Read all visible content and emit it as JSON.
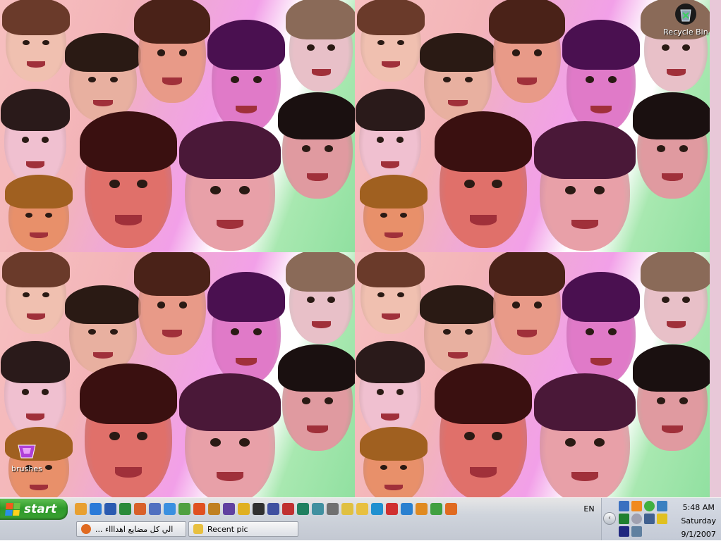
{
  "desktop": {
    "icons": [
      {
        "label": "Recycle Bin",
        "icon": "recycle-bin-icon"
      },
      {
        "label": "brushes",
        "icon": "brushes-icon"
      }
    ]
  },
  "taskbar": {
    "start_label": "start",
    "quick_launch": [
      {
        "icon": "outlook-icon",
        "color": "#e8a030"
      },
      {
        "icon": "internet-explorer-icon",
        "color": "#2a7ad8"
      },
      {
        "icon": "word-icon",
        "color": "#2a5ab0"
      },
      {
        "icon": "excel-icon",
        "color": "#2a8a3a"
      },
      {
        "icon": "powerpoint-icon",
        "color": "#d8602a"
      },
      {
        "icon": "notepad-icon",
        "color": "#5070c0"
      },
      {
        "icon": "ie-alt-icon",
        "color": "#3a90e0"
      },
      {
        "icon": "paint-icon",
        "color": "#50a040"
      },
      {
        "icon": "media-icon",
        "color": "#e05020"
      },
      {
        "icon": "winamp-icon",
        "color": "#c08020"
      },
      {
        "icon": "gallery-icon",
        "color": "#6040a0"
      },
      {
        "icon": "norton-icon",
        "color": "#e0b020"
      },
      {
        "icon": "audio-icon",
        "color": "#303030"
      },
      {
        "icon": "tool-icon",
        "color": "#4050a0"
      },
      {
        "icon": "game-icon",
        "color": "#c03030"
      },
      {
        "icon": "compass-icon",
        "color": "#208060"
      },
      {
        "icon": "monitor-icon",
        "color": "#4090a0"
      },
      {
        "icon": "network-icon",
        "color": "#707070"
      },
      {
        "icon": "folder-download-icon",
        "color": "#e0c040"
      },
      {
        "icon": "folder-icon",
        "color": "#e8c040"
      },
      {
        "icon": "media-player-icon",
        "color": "#2090d0"
      },
      {
        "icon": "mushroom-icon",
        "color": "#d03030"
      },
      {
        "icon": "play-icon",
        "color": "#2a80d0"
      },
      {
        "icon": "vlc-icon",
        "color": "#e08a20"
      },
      {
        "icon": "messenger-icon",
        "color": "#40a040"
      },
      {
        "icon": "firefox-icon",
        "color": "#e06a20"
      }
    ],
    "tasks": [
      {
        "label": "الي كل مضايع اهداااء ...",
        "icon": "firefox-icon",
        "color": "#e06a20"
      },
      {
        "label": "Recent pic",
        "icon": "folder-icon",
        "color": "#e8c040"
      }
    ],
    "language": "EN"
  },
  "tray": {
    "time": "5:48 AM",
    "day": "Saturday",
    "date": "9/1/2007"
  }
}
